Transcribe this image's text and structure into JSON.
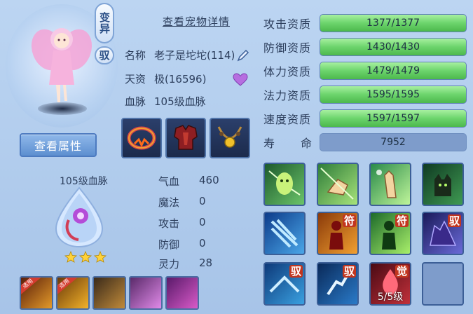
{
  "pet": {
    "mutation_label": "变异",
    "tamed_label": "驭",
    "details_link": "查看宠物详情",
    "name_label": "名称",
    "name_value": "老子是坨坨(114)",
    "talent_label": "天资",
    "talent_value": "极(16596)",
    "bloodline_label": "血脉",
    "bloodline_value": "105级血脉",
    "view_attributes_label": "查看属性"
  },
  "aptitudes": [
    {
      "label": "攻击资质",
      "value": "1377/1377",
      "fill": 1.0
    },
    {
      "label": "防御资质",
      "value": "1430/1430",
      "fill": 1.0
    },
    {
      "label": "体力资质",
      "value": "1479/1479",
      "fill": 1.0
    },
    {
      "label": "法力资质",
      "value": "1595/1595",
      "fill": 1.0
    },
    {
      "label": "速度资质",
      "value": "1597/1597",
      "fill": 1.0
    }
  ],
  "lifespan": {
    "label_a": "寿",
    "label_b": "命",
    "value": "7952"
  },
  "bloodline_stats": [
    {
      "label": "气血",
      "value": "460"
    },
    {
      "label": "魔法",
      "value": "0"
    },
    {
      "label": "攻击",
      "value": "0"
    },
    {
      "label": "防御",
      "value": "0"
    },
    {
      "label": "灵力",
      "value": "28"
    }
  ],
  "skills": {
    "talisman_tag": "符",
    "tame_tag": "驭",
    "awaken_tag": "觉",
    "awaken_level": "5/5级"
  },
  "items": {
    "equipped_ribbon": "适用"
  },
  "colors": {
    "bar_fill": "#6cd46c",
    "panel_bg": "#a7c4e8",
    "text": "#2c3e5c"
  }
}
